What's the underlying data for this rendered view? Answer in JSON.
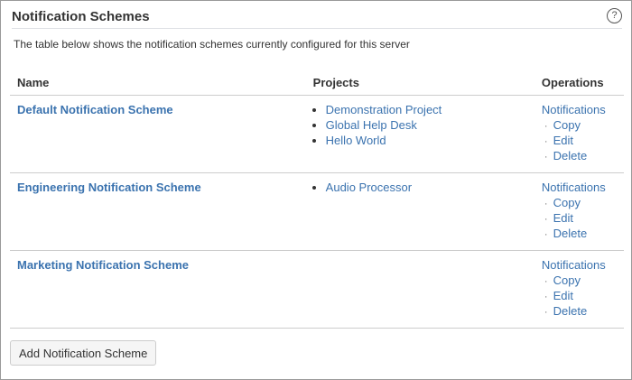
{
  "header": {
    "title": "Notification Schemes",
    "help_icon": "question-circle-icon"
  },
  "description": "The table below shows the notification schemes currently configured for this server",
  "table": {
    "columns": [
      "Name",
      "Projects",
      "Operations"
    ],
    "rows": [
      {
        "name": "Default Notification Scheme",
        "projects": [
          "Demonstration Project",
          "Global Help Desk",
          "Hello World"
        ]
      },
      {
        "name": "Engineering Notification Scheme",
        "projects": [
          "Audio Processor"
        ]
      },
      {
        "name": "Marketing Notification Scheme",
        "projects": []
      }
    ],
    "operations": {
      "notifications": "Notifications",
      "copy": "Copy",
      "edit": "Edit",
      "delete": "Delete",
      "bullet": "·"
    }
  },
  "add_button": "Add Notification Scheme",
  "colors": {
    "link": "#3b73af",
    "text": "#333333",
    "border": "#cccccc"
  }
}
